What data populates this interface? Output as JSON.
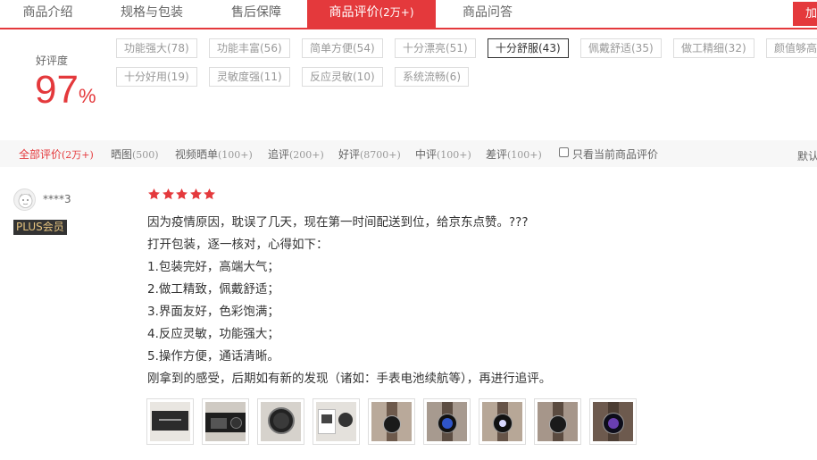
{
  "tabs": [
    {
      "label": "商品介绍",
      "count": ""
    },
    {
      "label": "规格与包装",
      "count": ""
    },
    {
      "label": "售后保障",
      "count": ""
    },
    {
      "label": "商品评价",
      "count": "(2万+)"
    },
    {
      "label": "商品问答",
      "count": ""
    }
  ],
  "add_cart_label": "加入购物车",
  "rating": {
    "label": "好评度",
    "value": "97",
    "unit": "%"
  },
  "tags": [
    "功能强大(78)",
    "功能丰富(56)",
    "简单方便(54)",
    "十分漂亮(51)",
    "十分舒服(43)",
    "佩戴舒适(35)",
    "做工精细(32)",
    "颜值够高",
    "十分好用(19)",
    "灵敏度强(11)",
    "反应灵敏(10)",
    "系统流畅(6)"
  ],
  "filters": [
    {
      "label": "全部评价",
      "count": "(2万+)"
    },
    {
      "label": "晒图",
      "count": "(500)"
    },
    {
      "label": "视频晒单",
      "count": "(100+)"
    },
    {
      "label": "追评",
      "count": "(200+)"
    },
    {
      "label": "好评",
      "count": "(8700+)"
    },
    {
      "label": "中评",
      "count": "(100+)"
    },
    {
      "label": "差评",
      "count": "(100+)"
    }
  ],
  "only_current_label": "只看当前商品评价",
  "sort_label": "默认",
  "review": {
    "username": "****3",
    "badge": "PLUS会员",
    "stars": 5,
    "lines": [
      "因为疫情原因，耽误了几天，现在第一时间配送到位，给京东点赞。???",
      "打开包装，逐一核对，心得如下：",
      "1.包装完好，高端大气；",
      "2.做工精致，佩戴舒适；",
      "3.界面友好，色彩饱满；",
      "4.反应灵敏，功能强大；",
      "5.操作方便，通话清晰。",
      "刚拿到的感受，后期如有新的发现（诸如：手表电池续航等），再进行追评。"
    ],
    "thumbs": [
      "box-photo",
      "box-open-photo",
      "watch-face-photo",
      "unboxed-photo",
      "watch-wrist-photo",
      "watch-screen-photo",
      "watch-screen-photo",
      "watch-wrist-photo",
      "watch-screen-photo"
    ]
  },
  "colors": {
    "accent": "#e4393c",
    "star": "#e4393c"
  }
}
